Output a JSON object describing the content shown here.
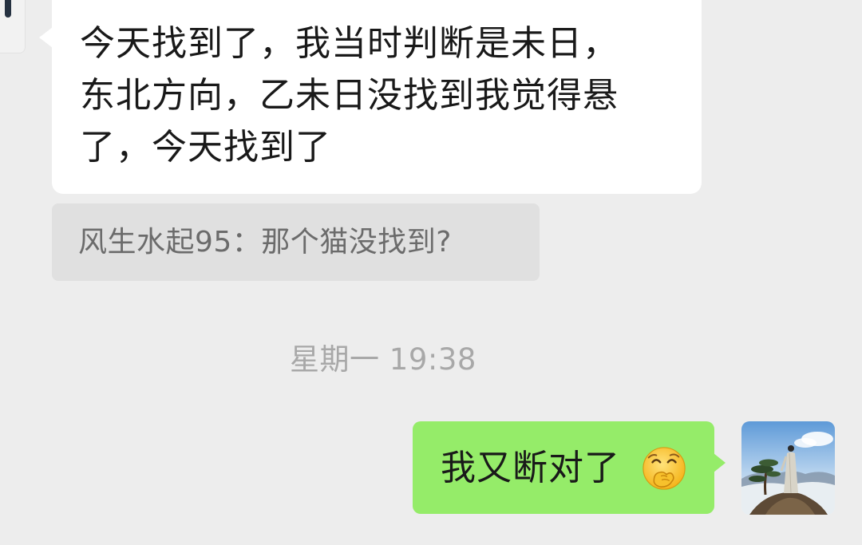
{
  "incoming_message": {
    "lines": [
      "今天找到了，我当时判断是未日，",
      "东北方向，乙未日没找到我觉得悬",
      "了，今天找到了"
    ]
  },
  "quote": {
    "text": "风生水起95：那个猫没找到?"
  },
  "timestamp": "星期一 19:38",
  "outgoing_message": {
    "text": "我又断对了",
    "emoji": "smirking-covering-mouth-emoji"
  },
  "colors": {
    "background": "#ededed",
    "incoming_bubble": "#ffffff",
    "outgoing_bubble": "#95ec69",
    "quote_bg": "#e0e0e0"
  }
}
